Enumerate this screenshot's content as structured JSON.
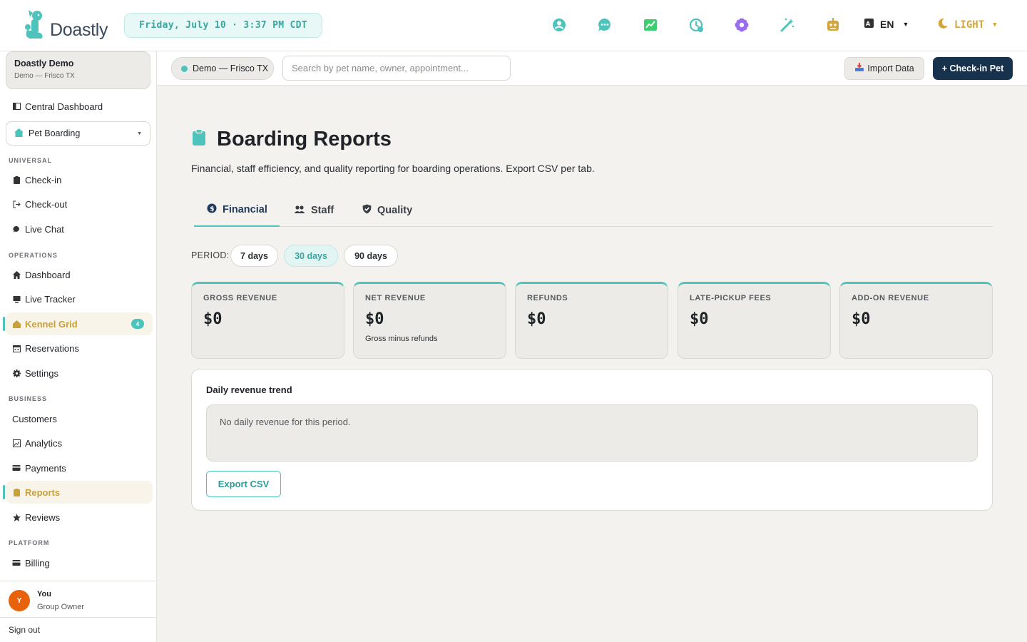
{
  "app": {
    "name": "Doastly"
  },
  "header": {
    "datetime": "Friday, July 10 · 3:37 PM CDT",
    "language": "EN",
    "theme": "LIGHT",
    "icons": [
      "support-icon",
      "chat-icon",
      "chart-icon",
      "history-icon",
      "flower-icon",
      "magic-wand-icon",
      "robot-icon"
    ]
  },
  "sidebar": {
    "org_name": "Doastly Demo",
    "org_location": "Demo — Frisco TX",
    "central_dashboard": "Central Dashboard",
    "department": "Pet Boarding",
    "sections": {
      "universal": "UNIVERSAL",
      "operations": "OPERATIONS",
      "business": "BUSINESS",
      "platform": "PLATFORM"
    },
    "universal_items": [
      "Check-in",
      "Check-out",
      "Live Chat"
    ],
    "operations_items": [
      "Dashboard",
      "Live Tracker",
      "Kennel Grid",
      "Reservations",
      "Settings"
    ],
    "kennel_badge": "4",
    "business_items": [
      "Customers",
      "Analytics",
      "Payments",
      "Reports",
      "Reviews"
    ],
    "platform_items": [
      "Billing"
    ],
    "user": {
      "initial": "Y",
      "name": "You",
      "role": "Group Owner"
    },
    "sign_out": "Sign out"
  },
  "subheader": {
    "location": "Demo — Frisco TX",
    "search_placeholder": "Search by pet name, owner, appointment...",
    "import_label": "Import Data",
    "checkin_label": "+ Check-in Pet"
  },
  "main": {
    "title": "Boarding Reports",
    "subtitle": "Financial, staff efficiency, and quality reporting for boarding operations. Export CSV per tab.",
    "tabs": [
      "Financial",
      "Staff",
      "Quality"
    ],
    "active_tab": "Financial",
    "period_label": "PERIOD:",
    "periods": [
      "7 days",
      "30 days",
      "90 days"
    ],
    "active_period": "30 days",
    "kpis": [
      {
        "label": "GROSS REVENUE",
        "value": "$0",
        "sub": ""
      },
      {
        "label": "NET REVENUE",
        "value": "$0",
        "sub": "Gross minus refunds"
      },
      {
        "label": "REFUNDS",
        "value": "$0",
        "sub": ""
      },
      {
        "label": "LATE-PICKUP FEES",
        "value": "$0",
        "sub": ""
      },
      {
        "label": "ADD-ON REVENUE",
        "value": "$0",
        "sub": ""
      }
    ],
    "trend": {
      "title": "Daily revenue trend",
      "empty_message": "No daily revenue for this period.",
      "export_label": "Export CSV"
    }
  },
  "colors": {
    "accent": "#4ec3bb",
    "gold": "#c9a13a",
    "navy": "#17324d",
    "avatar": "#e8620b"
  }
}
